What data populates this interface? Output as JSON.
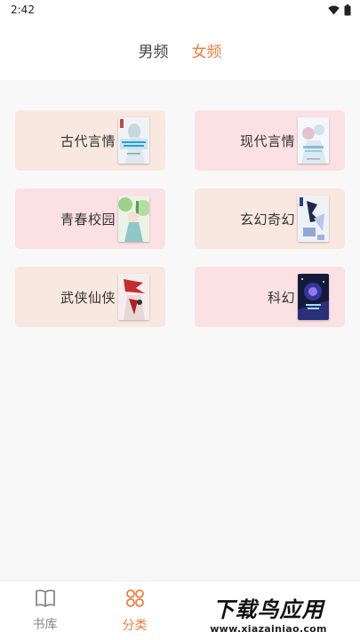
{
  "status_bar": {
    "time": "2:42"
  },
  "tabs": [
    {
      "label": "男频",
      "active": false
    },
    {
      "label": "女频",
      "active": true
    }
  ],
  "categories": [
    {
      "label": "古代言情",
      "color": "#f9e8df",
      "cover": "ancient-romance-cover"
    },
    {
      "label": "现代言情",
      "color": "#fbe1e3",
      "cover": "modern-romance-cover"
    },
    {
      "label": "青春校园",
      "color": "#fbe1e3",
      "cover": "youth-campus-cover"
    },
    {
      "label": "玄幻奇幻",
      "color": "#f9e8df",
      "cover": "fantasy-cover"
    },
    {
      "label": "武侠仙侠",
      "color": "#f9e8df",
      "cover": "wuxia-cover"
    },
    {
      "label": "科幻",
      "color": "#fbe1e3",
      "cover": "scifi-cover"
    }
  ],
  "bottom_nav": [
    {
      "label": "书库",
      "icon": "book-icon",
      "active": false
    },
    {
      "label": "分类",
      "icon": "category-icon",
      "active": true
    },
    {
      "label": "",
      "icon": "",
      "active": false
    },
    {
      "label": "",
      "icon": "",
      "active": false
    }
  ],
  "watermark": {
    "main": "下载鸟应用",
    "url": "www.xiazainiao.com"
  },
  "accent_color": "#f07d3c"
}
